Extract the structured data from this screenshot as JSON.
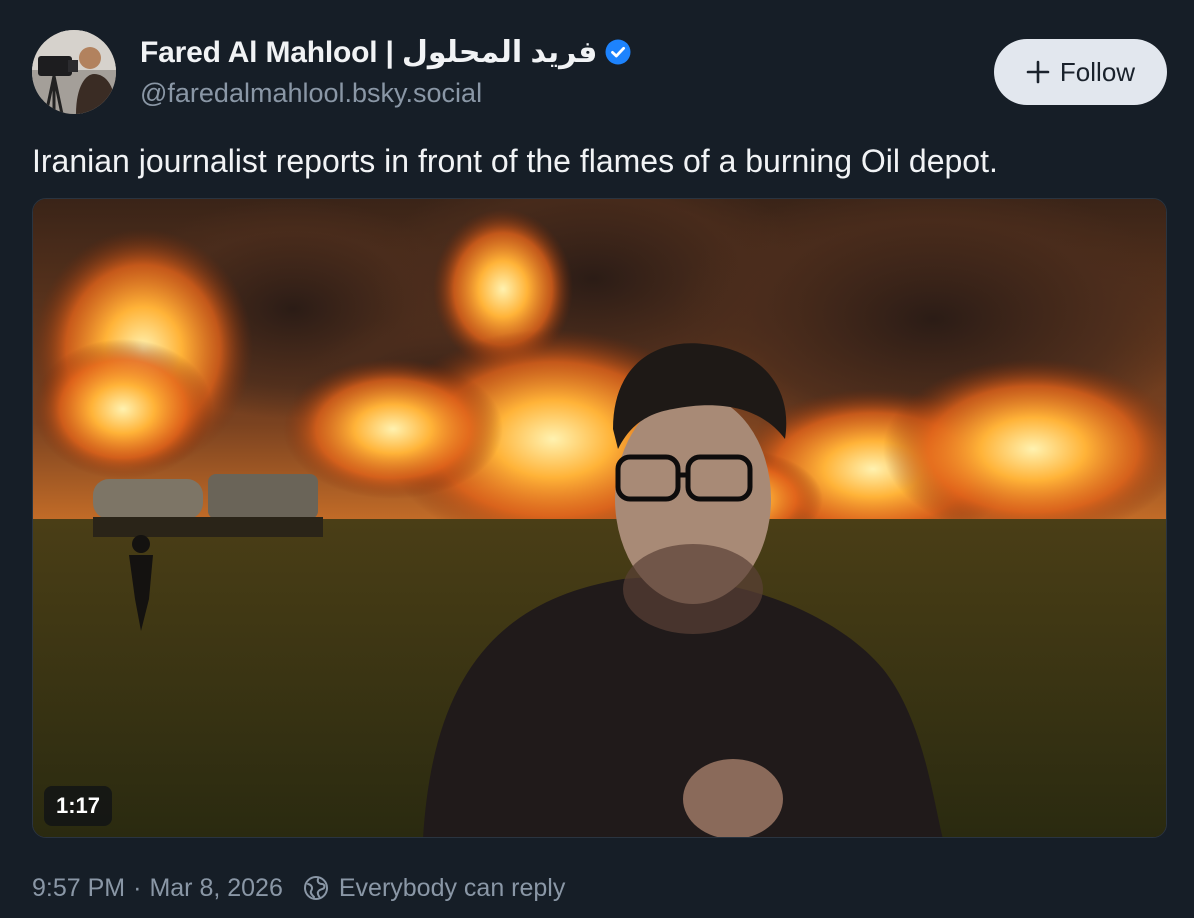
{
  "author": {
    "display_name": "Fared Al Mahlool | فريد المحلول",
    "handle": "@faredalmahlool.bsky.social",
    "verified": true,
    "avatar_icon": "user-avatar"
  },
  "follow_button": {
    "label": "Follow",
    "icon": "plus-icon"
  },
  "post": {
    "text": "Iranian journalist reports in front of the flames of a burning Oil depot.",
    "video": {
      "duration": "1:17"
    }
  },
  "meta": {
    "timestamp": "9:57 PM",
    "separator": "·",
    "date": "Mar 8, 2026",
    "reply_setting": "Everybody can reply",
    "reply_icon": "globe-icon"
  },
  "colors": {
    "background": "#161e27",
    "verified_blue": "#1d83fd",
    "muted_text": "#8a97a6",
    "follow_bg": "#e2e7ee"
  }
}
